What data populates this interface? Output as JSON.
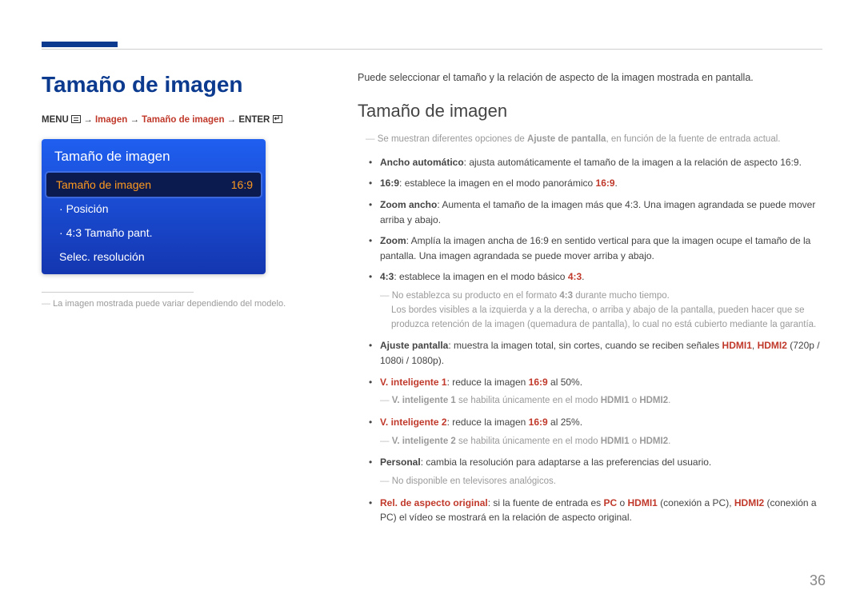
{
  "page_number": "36",
  "left": {
    "title": "Tamaño de imagen",
    "breadcrumb": {
      "menu_label": "MENU",
      "p1": "Imagen",
      "p2": "Tamaño de imagen",
      "enter_label": "ENTER",
      "arrow": "→"
    },
    "card": {
      "title": "Tamaño de imagen",
      "items": [
        {
          "label": "Tamaño de imagen",
          "value": "16:9",
          "selected": true
        },
        {
          "label": "Posición",
          "value": "",
          "sub": true
        },
        {
          "label": "4:3 Tamaño pant.",
          "value": "",
          "sub": true
        },
        {
          "label": "Selec. resolución",
          "value": ""
        }
      ]
    },
    "footnote": "La imagen mostrada puede variar dependiendo del modelo."
  },
  "right": {
    "intro": "Puede seleccionar el tamaño y la relación de aspecto de la imagen mostrada en pantalla.",
    "heading": "Tamaño de imagen",
    "pre_note_a": "Se muestran diferentes opciones de ",
    "pre_note_bold": "Ajuste de pantalla",
    "pre_note_b": ", en función de la fuente de entrada actual.",
    "opts": {
      "o0a": "Ancho automático",
      "o0b": ": ajusta automáticamente el tamaño de la imagen a la relación de aspecto 16:9.",
      "o1a": "16:9",
      "o1b": ": establece la imagen en el modo panorámico ",
      "o1c": "16:9",
      "o1d": ".",
      "o2a": "Zoom ancho",
      "o2b": ": Aumenta el tamaño de la imagen más que 4:3. Una imagen agrandada se puede mover arriba y abajo.",
      "o3a": "Zoom",
      "o3b": ": Amplía la imagen ancha de 16:9 en sentido vertical para que la imagen ocupe el tamaño de la pantalla. Una imagen agrandada se puede mover arriba y abajo.",
      "o4a": "4:3",
      "o4b": ": establece la imagen en el modo básico ",
      "o4c": "4:3",
      "o4d": ".",
      "o4_sub1a": "No establezca su producto en el formato ",
      "o4_sub1b": "4:3",
      "o4_sub1c": " durante mucho tiempo.",
      "o4_sub2": "Los bordes visibles a la izquierda y a la derecha, o arriba y abajo de la pantalla, pueden hacer que se produzca retención de la imagen (quemadura de pantalla), lo cual no está cubierto mediante la garantía.",
      "o5a": "Ajuste pantalla",
      "o5b": ": muestra la imagen total, sin cortes, cuando se reciben señales ",
      "o5c": "HDMI1",
      "o5d": ", ",
      "o5e": "HDMI2",
      "o5f": " (720p / 1080i / 1080p).",
      "o6a": "V. inteligente 1",
      "o6b": ": reduce la imagen ",
      "o6c": "16:9",
      "o6d": " al 50%.",
      "o6_sub_a": "V. inteligente 1",
      "o6_sub_b": " se habilita únicamente en el modo ",
      "o6_sub_c": "HDMI1",
      "o6_sub_d": " o ",
      "o6_sub_e": "HDMI2",
      "o6_sub_f": ".",
      "o7a": "V. inteligente 2",
      "o7b": ": reduce la imagen ",
      "o7c": "16:9",
      "o7d": " al 25%.",
      "o7_sub_a": "V. inteligente 2",
      "o7_sub_b": " se habilita únicamente en el modo ",
      "o7_sub_c": "HDMI1",
      "o7_sub_d": " o ",
      "o7_sub_e": "HDMI2",
      "o7_sub_f": ".",
      "o8a": "Personal",
      "o8b": ": cambia la resolución para adaptarse a las preferencias del usuario.",
      "o8_sub": "No disponible en televisores analógicos.",
      "o9a": "Rel. de aspecto original",
      "o9b": ": si la fuente de entrada es ",
      "o9c": "PC",
      "o9d": " o ",
      "o9e": "HDMI1",
      "o9f": " (conexión a PC), ",
      "o9g": "HDMI2",
      "o9h": " (conexión a PC) el vídeo se mostrará en la relación de aspecto original."
    }
  }
}
